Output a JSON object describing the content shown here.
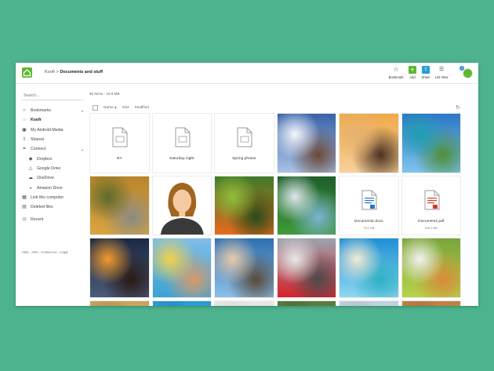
{
  "app": {
    "breadcrumb": {
      "root": "Koofr",
      "separator": ">",
      "current": "Documents and stuff"
    }
  },
  "toolbar": {
    "bookmark": {
      "label": "Bookmark",
      "icon": "star-icon"
    },
    "add": {
      "label": "Add",
      "icon": "plus-icon",
      "color": "#5fb832"
    },
    "share": {
      "label": "Share",
      "icon": "share-icon",
      "color": "#2a9bd6"
    },
    "list_view": {
      "label": "List View",
      "icon": "list-icon"
    },
    "avatar_badge": "1"
  },
  "sidebar": {
    "search_placeholder": "Search...",
    "items": [
      {
        "label": "Bookmarks",
        "icon": "star-icon",
        "caret": "▾"
      },
      {
        "label": "Koofr",
        "icon": "koofr-icon",
        "active": true
      },
      {
        "label": "My Android Media",
        "icon": "android-icon"
      },
      {
        "label": "Shared",
        "icon": "share-icon"
      },
      {
        "label": "Connect",
        "icon": "link-icon",
        "caret": "▴"
      },
      {
        "label": "Dropbox",
        "icon": "dropbox-icon",
        "sub": true
      },
      {
        "label": "Google Drive",
        "icon": "google-drive-icon",
        "sub": true
      },
      {
        "label": "OneDrive",
        "icon": "onedrive-icon",
        "sub": true
      },
      {
        "label": "Amazon Drive",
        "icon": "amazon-drive-icon",
        "sub": true
      },
      {
        "label": "Link this computer",
        "icon": "computer-icon"
      },
      {
        "label": "Deleted files",
        "icon": "trash-icon"
      },
      {
        "label": "Recent",
        "icon": "clock-icon"
      }
    ],
    "footer": "Help · Intro · Contact us · Legal"
  },
  "main": {
    "count": "65 items - 16.8 MB",
    "columns": {
      "name": "Name",
      "name_sort": "▴",
      "size": "Size",
      "modified": "Modified"
    },
    "tiles": [
      {
        "type": "folder",
        "name": "NY"
      },
      {
        "type": "folder",
        "name": "Saturday night"
      },
      {
        "type": "folder",
        "name": "Spring photos"
      },
      {
        "type": "photo",
        "scene": "snow-mountain",
        "colors": [
          "#3a62a8",
          "#a9c2e6",
          "#f4f6fb",
          "#6b4a3a"
        ]
      },
      {
        "type": "photo",
        "scene": "sunset-girl",
        "colors": [
          "#f0a94a",
          "#f7d09a",
          "#e6b270",
          "#4a3222"
        ]
      },
      {
        "type": "photo",
        "scene": "tropical-island",
        "colors": [
          "#2b78c4",
          "#7fc3ee",
          "#1e9fb0",
          "#4f8f3a"
        ]
      },
      {
        "type": "photo",
        "scene": "autumn-road",
        "colors": [
          "#b8862a",
          "#d9a441",
          "#5c6a2c",
          "#8a8a86"
        ]
      },
      {
        "type": "photo",
        "scene": "avatar-woman",
        "colors": [
          "#ffffff",
          "#a0651f",
          "#f5c9a2",
          "#3a3a3a"
        ]
      },
      {
        "type": "photo",
        "scene": "butterflies",
        "colors": [
          "#3e7a2a",
          "#e96a1d",
          "#8fbf3a",
          "#2a4a1a"
        ]
      },
      {
        "type": "photo",
        "scene": "waterfall",
        "colors": [
          "#1f5e2a",
          "#3f9a3a",
          "#dfe9f0",
          "#7bb4d2"
        ]
      },
      {
        "type": "file",
        "name": "Document1.docx",
        "size": "79.1 KB",
        "icon": "docx-icon",
        "accent": "#2a74d2"
      },
      {
        "type": "file",
        "name": "Document1.pdf",
        "size": "239.2 KB",
        "icon": "pdf-icon",
        "accent": "#d93a2a"
      },
      {
        "type": "photo",
        "scene": "campfire",
        "colors": [
          "#1b2a44",
          "#4a5a7a",
          "#f29a2a",
          "#2a1a12"
        ]
      },
      {
        "type": "photo",
        "scene": "beach-family",
        "colors": [
          "#7fbde8",
          "#3aa3d2",
          "#f2d24a",
          "#d89a6a"
        ]
      },
      {
        "type": "photo",
        "scene": "hat-girl-sea",
        "colors": [
          "#2f6fb0",
          "#8cc0e8",
          "#e8c9a8",
          "#5a4a3a"
        ]
      },
      {
        "type": "photo",
        "scene": "red-car",
        "colors": [
          "#9aa4ad",
          "#d8212a",
          "#e8e8e8",
          "#4a4a4a"
        ]
      },
      {
        "type": "photo",
        "scene": "beach",
        "colors": [
          "#1f8fd6",
          "#8fd6f2",
          "#f2ead2",
          "#2fb2c2"
        ]
      },
      {
        "type": "photo",
        "scene": "kitten",
        "colors": [
          "#7aa43a",
          "#b8d24a",
          "#f2f2ee",
          "#d98a3a"
        ]
      },
      {
        "type": "photo",
        "scene": "partial-1",
        "colors": [
          "#c8a45a",
          "#e0c070",
          "#a08040",
          "#d8b060"
        ]
      },
      {
        "type": "photo",
        "scene": "partial-2",
        "colors": [
          "#2a9ad0",
          "#60b8e0",
          "#1a7ab0",
          "#8ad0f0"
        ]
      },
      {
        "type": "photo",
        "scene": "partial-3",
        "colors": [
          "#e8e8e8",
          "#c0c0c0",
          "#d0d0d0",
          "#f0f0f0"
        ]
      },
      {
        "type": "photo",
        "scene": "partial-4",
        "colors": [
          "#5a7a3a",
          "#8aa44a",
          "#3a5a2a",
          "#a0b860"
        ]
      },
      {
        "type": "photo",
        "scene": "partial-5",
        "colors": [
          "#c0d0e0",
          "#e0e8f0",
          "#a0b0c0",
          "#d0e0f0"
        ]
      },
      {
        "type": "photo",
        "scene": "partial-6",
        "colors": [
          "#c08040",
          "#e0a060",
          "#a06030",
          "#d09050"
        ]
      }
    ]
  }
}
